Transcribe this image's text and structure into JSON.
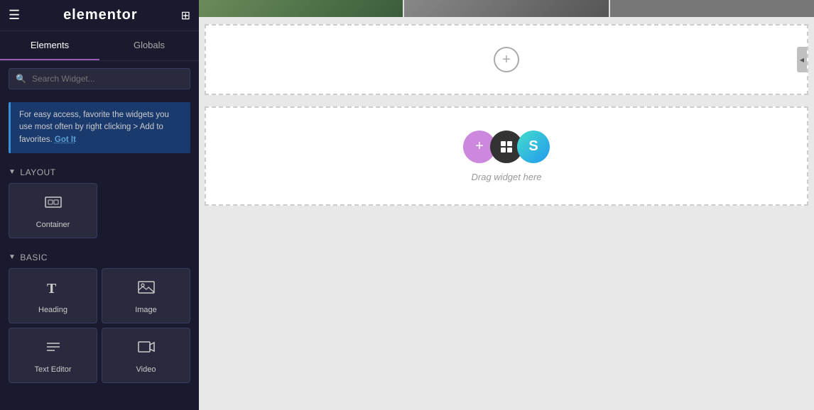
{
  "header": {
    "hamburger_icon": "☰",
    "logo": "elementor",
    "grid_icon": "⊞"
  },
  "tabs": {
    "elements_label": "Elements",
    "globals_label": "Globals",
    "active": "Elements"
  },
  "search": {
    "placeholder": "Search Widget..."
  },
  "tip": {
    "text": "For easy access, favorite the widgets you use most often by right clicking > Add to favorites.",
    "got_it_label": "Got It"
  },
  "sections": {
    "layout_label": "Layout",
    "basic_label": "Basic"
  },
  "widgets": {
    "layout": [
      {
        "id": "container",
        "label": "Container",
        "icon": "container"
      }
    ],
    "basic": [
      {
        "id": "heading",
        "label": "Heading",
        "icon": "heading"
      },
      {
        "id": "image",
        "label": "Image",
        "icon": "image"
      },
      {
        "id": "text-editor",
        "label": "Text Editor",
        "icon": "text"
      },
      {
        "id": "video",
        "label": "Video",
        "icon": "video"
      }
    ]
  },
  "canvas": {
    "plus_label": "+",
    "drag_text": "Drag widget here",
    "drag_icons": [
      "pink-plus",
      "dark-folder",
      "green-s"
    ]
  },
  "colors": {
    "sidebar_bg": "#1a1a2e",
    "accent": "#9b59b6",
    "tip_bg": "#1a3a6e",
    "widget_bg": "#2a2a3e",
    "dashed_border": "#cccccc"
  }
}
